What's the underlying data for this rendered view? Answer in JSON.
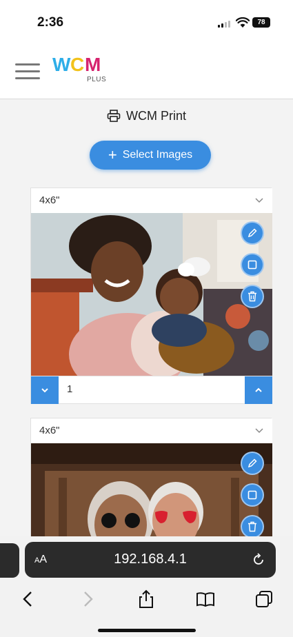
{
  "status_bar": {
    "time": "2:36",
    "battery": "78"
  },
  "header": {
    "logo_main": "WCM",
    "logo_sub": "PLUS"
  },
  "page": {
    "title": "WCM Print",
    "select_button_label": "Select Images"
  },
  "cards": [
    {
      "size": "4x6\"",
      "quantity": "1"
    },
    {
      "size": "4x6\""
    }
  ],
  "browser": {
    "aa_label_small": "A",
    "aa_label_large": "A",
    "url": "192.168.4.1"
  },
  "colors": {
    "accent": "#3a8de0",
    "logo_w": "#2eaee8",
    "logo_c": "#f2c21b",
    "logo_m": "#d6246e"
  },
  "icons": [
    "menu-icon",
    "printer-icon",
    "plus-icon",
    "chevron-down-icon",
    "edit-pencil-icon",
    "crop-square-icon",
    "trash-icon",
    "chevron-up-icon",
    "reload-icon",
    "back-icon",
    "forward-icon",
    "share-icon",
    "bookmarks-icon",
    "tabs-icon"
  ]
}
